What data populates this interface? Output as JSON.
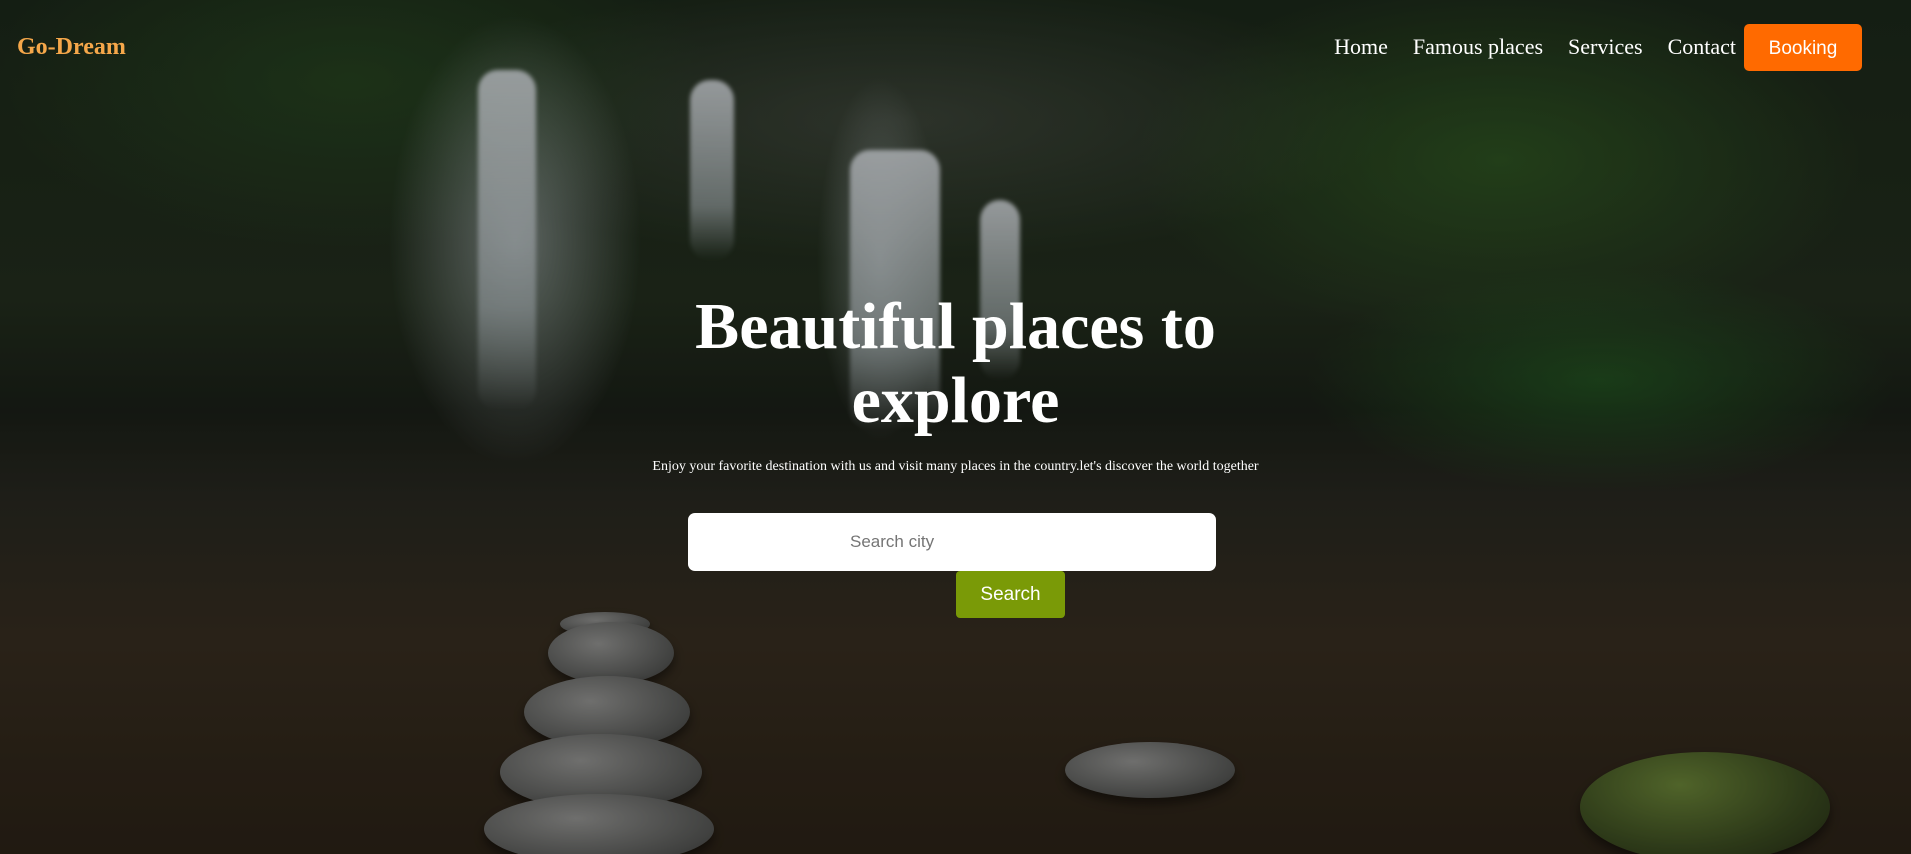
{
  "brand": {
    "name": "Go-Dream",
    "color": "#f5a74a"
  },
  "nav": {
    "links": [
      {
        "label": "Home"
      },
      {
        "label": "Famous places"
      },
      {
        "label": "Services"
      },
      {
        "label": "Contact"
      }
    ],
    "booking_label": "Booking",
    "booking_color": "#ff6a00"
  },
  "hero": {
    "title": "Beautiful places to explore",
    "subtitle": "Enjoy your favorite destination with us and visit many places in the country.let's discover the world together",
    "background_image": "waterfall-forest-lake-photo"
  },
  "search": {
    "placeholder": "Search city",
    "value": "",
    "button_label": "Search",
    "button_color": "#7a9a07"
  }
}
